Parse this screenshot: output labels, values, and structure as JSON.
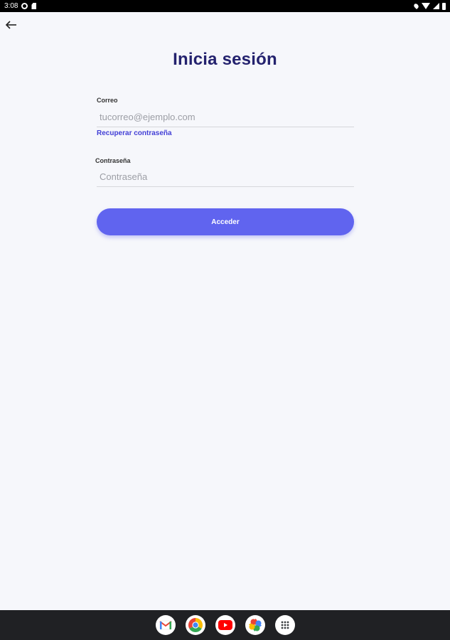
{
  "statusbar": {
    "time": "3:08"
  },
  "page": {
    "title": "Inicia sesión"
  },
  "form": {
    "email_label": "Correo",
    "email_placeholder": "tucorreo@ejemplo.com",
    "recover_link": "Recuperar contraseña",
    "password_label": "Contraseña",
    "password_placeholder": "Contraseña",
    "submit_label": "Acceder"
  },
  "colors": {
    "title": "#24226e",
    "accent": "#6064ef",
    "link": "#4340d6",
    "background": "#f6f7fb"
  },
  "dock": {
    "apps": [
      "gmail-icon",
      "chrome-icon",
      "youtube-icon",
      "photos-icon",
      "app-drawer-icon"
    ]
  }
}
